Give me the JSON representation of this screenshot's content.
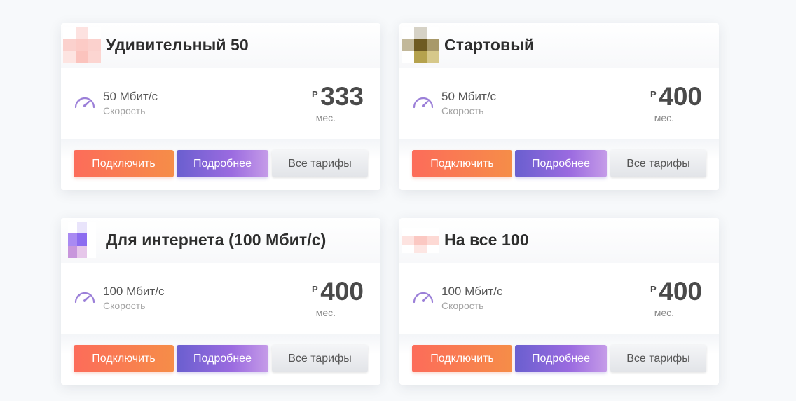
{
  "tariffs": [
    {
      "name": "Удивительный 50",
      "speed_value": "50 Мбит/с",
      "speed_label": "Скорость",
      "currency": "Р",
      "price": "333",
      "period": "мес.",
      "buttons": {
        "connect": "Подключить",
        "more": "Подробнее",
        "all": "Все тарифы"
      },
      "logo_colors": [
        "#ffffff",
        "#fde2e0",
        "#ffffff",
        "#fbd1cd",
        "#fccbc6",
        "#fbd1cd",
        "#fde4e1",
        "#fbc3bd",
        "#fcd5d1"
      ]
    },
    {
      "name": "Стартовый",
      "speed_value": "50 Мбит/с",
      "speed_label": "Скорость",
      "currency": "Р",
      "price": "400",
      "period": "мес.",
      "buttons": {
        "connect": "Подключить",
        "more": "Подробнее",
        "all": "Все тарифы"
      },
      "logo_colors": [
        "#ffffff",
        "#d6d2c6",
        "#ffffff",
        "#c2b89a",
        "#6e5a22",
        "#a8996a",
        "#ffffff",
        "#b5a24e",
        "#d6c88a"
      ]
    },
    {
      "name": "Для интернета (100 Мбит/с)",
      "speed_value": "100 Мбит/с",
      "speed_label": "Скорость",
      "currency": "Р",
      "price": "400",
      "period": "мес.",
      "buttons": {
        "connect": "Подключить",
        "more": "Подробнее",
        "all": "Все тарифы"
      },
      "logo_colors": [
        "#ffffff",
        "#e9e4fb",
        "#ffffff",
        "#a98af2",
        "#8c6cf0",
        "#ffffff",
        "#c896dc",
        "#e6c6ea",
        "#ffffff"
      ]
    },
    {
      "name": "На все 100",
      "speed_value": "100 Мбит/с",
      "speed_label": "Скорость",
      "currency": "Р",
      "price": "400",
      "period": "мес.",
      "buttons": {
        "connect": "Подключить",
        "more": "Подробнее",
        "all": "Все тарифы"
      },
      "logo_colors": [
        "#ffffff",
        "#ffffff",
        "#ffffff",
        "#fde3e0",
        "#fbc8c2",
        "#fdd9d4",
        "#ffffff",
        "#fde6e3",
        "#ffffff"
      ]
    }
  ],
  "accent": {
    "connect": "#f97a52",
    "more": "#7d62d9",
    "gauge": "#9b7fd8"
  }
}
